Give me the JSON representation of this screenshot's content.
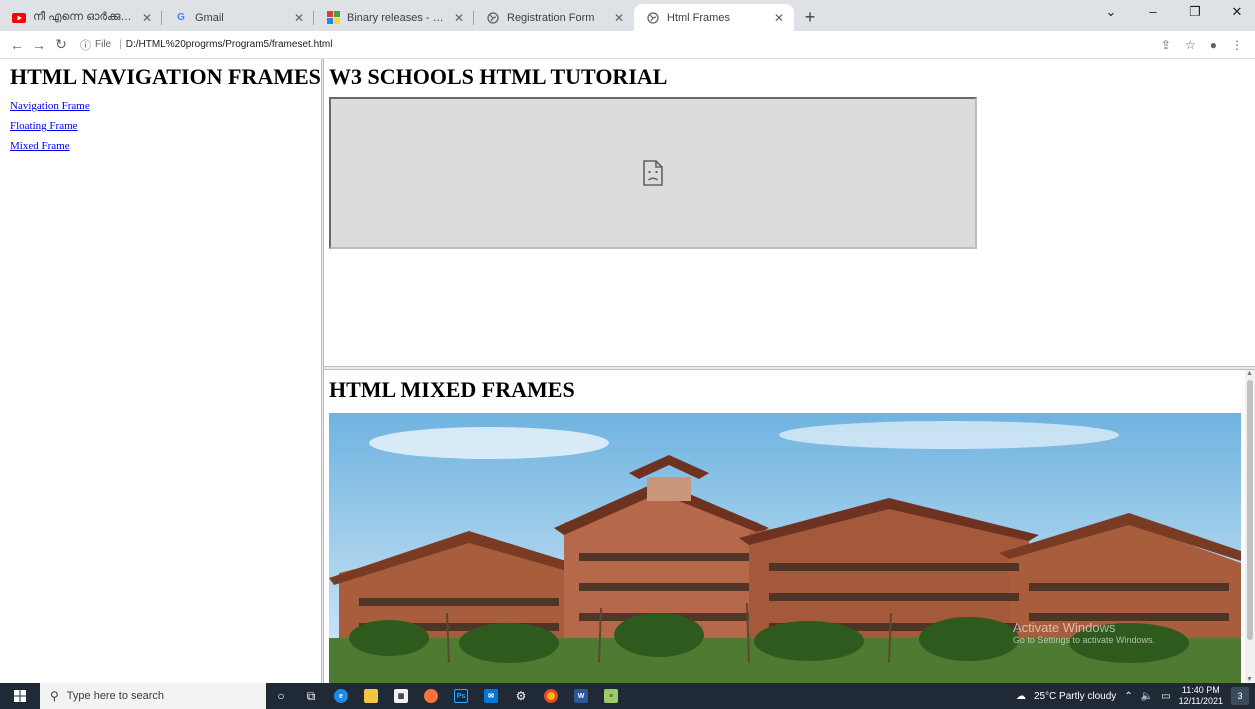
{
  "browser": {
    "tabs": [
      {
        "title": "നീ എന്നെ ഓർക്കുമോ...",
        "favicon": "youtube-icon",
        "favicon_color": "#ff0000",
        "active": false
      },
      {
        "title": "Gmail",
        "favicon": "google-icon",
        "favicon_color": "#4285f4",
        "active": false
      },
      {
        "title": "Binary releases - Code::Blocks",
        "favicon": "codeblocks-icon",
        "favicon_color": "#e53935",
        "active": false
      },
      {
        "title": "Registration Form",
        "favicon": "globe-icon",
        "favicon_color": "#5f6368",
        "active": false
      },
      {
        "title": "Html Frames",
        "favicon": "globe-icon",
        "favicon_color": "#5f6368",
        "active": true
      }
    ],
    "address": {
      "scheme_label": "File",
      "url": "D:/HTML%20progrms/Program5/frameset.html"
    }
  },
  "nav_frame": {
    "heading": "HTML NAVIGATION FRAMES",
    "links": [
      "Navigation Frame",
      "Floating Frame",
      "Mixed Frame"
    ]
  },
  "top_frame": {
    "heading": "W3 SCHOOLS HTML TUTORIAL",
    "iframe_state": "sad-file-icon"
  },
  "bottom_frame": {
    "heading": "HTML MIXED FRAMES",
    "image_subject": "college building photo",
    "watermark_line1": "Activate Windows",
    "watermark_line2": "Go to Settings to activate Windows."
  },
  "taskbar": {
    "search_placeholder": "Type here to search",
    "weather": "25°C  Partly cloudy",
    "time": "11:40 PM",
    "date": "12/11/2021",
    "notifications": "3"
  },
  "colors": {
    "link": "#0000ee",
    "tabbar": "#dee1e6",
    "taskbar": "#202a37"
  }
}
